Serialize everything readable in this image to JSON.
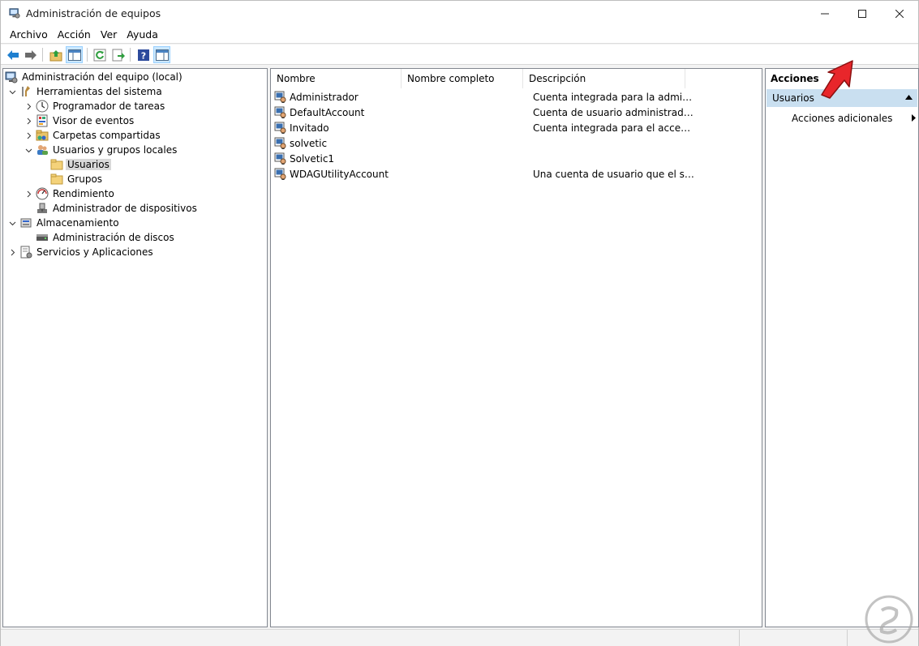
{
  "window": {
    "title": "Administración de equipos",
    "controls": [
      "minimize-icon",
      "maximize-icon",
      "close-icon"
    ]
  },
  "menubar": {
    "items": [
      {
        "label": "Archivo"
      },
      {
        "label": "Acción"
      },
      {
        "label": "Ver"
      },
      {
        "label": "Ayuda"
      }
    ]
  },
  "toolbar": {
    "buttons": [
      "back-icon",
      "forward-icon",
      "up-folder-icon",
      "show-hide-tree-icon",
      "refresh-icon",
      "export-list-icon",
      "help-icon",
      "show-hide-action-pane-icon"
    ]
  },
  "tree": {
    "root": "Administración del equipo (local)",
    "items": [
      {
        "label": "Herramientas del sistema"
      },
      {
        "label": "Programador de tareas"
      },
      {
        "label": "Visor de eventos"
      },
      {
        "label": "Carpetas compartidas"
      },
      {
        "label": "Usuarios y grupos locales"
      },
      {
        "label": "Usuarios"
      },
      {
        "label": "Grupos"
      },
      {
        "label": "Rendimiento"
      },
      {
        "label": "Administrador de dispositivos"
      },
      {
        "label": "Almacenamiento"
      },
      {
        "label": "Administración de discos"
      },
      {
        "label": "Servicios y Aplicaciones"
      }
    ]
  },
  "list": {
    "columns": [
      "Nombre",
      "Nombre completo",
      "Descripción"
    ],
    "rows": [
      {
        "name": "Administrador",
        "full": "",
        "desc": "Cuenta integrada para la administ..."
      },
      {
        "name": "DefaultAccount",
        "full": "",
        "desc": "Cuenta de usuario administrada p..."
      },
      {
        "name": "Invitado",
        "full": "",
        "desc": "Cuenta integrada para el acceso c..."
      },
      {
        "name": "solvetic",
        "full": "",
        "desc": ""
      },
      {
        "name": "Solvetic1",
        "full": "",
        "desc": ""
      },
      {
        "name": "WDAGUtilityAccount",
        "full": "",
        "desc": "Una cuenta de usuario que el siste..."
      }
    ]
  },
  "actions": {
    "header": "Acciones",
    "group": "Usuarios",
    "items": [
      {
        "label": "Acciones adicionales"
      }
    ]
  },
  "colors": {
    "selection": "#d9d9d9",
    "action_group_bg": "#c9dff0",
    "annotation_arrow": "#e8262b",
    "toolbar_active": "#cce8ff"
  }
}
